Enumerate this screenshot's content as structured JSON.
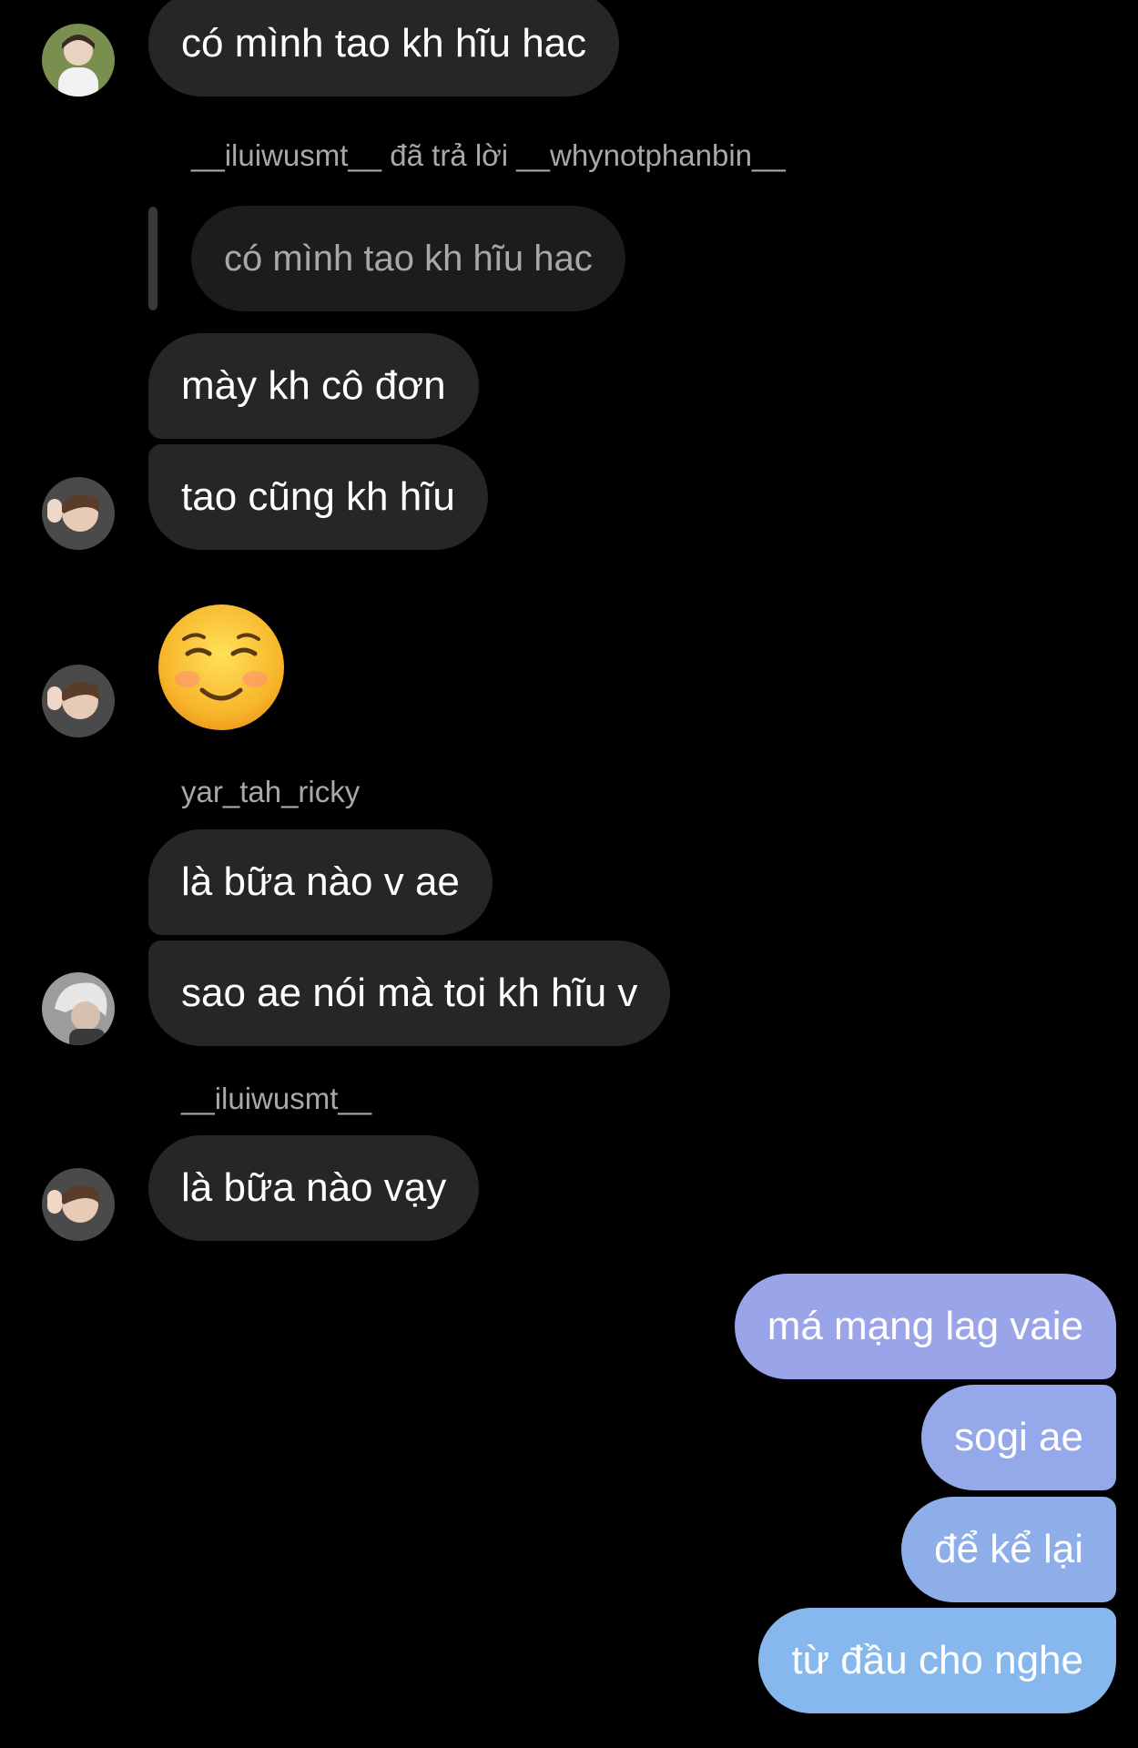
{
  "thread": {
    "messages": [
      {
        "text": "có mình tao kh hĩu hac"
      },
      {
        "reply_header": "__iluiwusmt__ đã trả lời __whynotphanbin__",
        "quoted": "có mình tao kh hĩu hac"
      },
      {
        "text": "mày kh cô đơn"
      },
      {
        "text": "tao cũng kh hĩu"
      },
      {
        "emoji": "smiling-face-icon"
      },
      {
        "sender": "yar_tah_ricky"
      },
      {
        "text": "là bữa nào v ae"
      },
      {
        "text": "sao ae nói mà toi kh hĩu v"
      },
      {
        "sender": "__iluiwusmt__"
      },
      {
        "text": "là bữa nào vạy"
      }
    ],
    "outgoing": [
      {
        "text": "má mạng lag vaie",
        "color": "#9aa4e8"
      },
      {
        "text": "sogi ae",
        "color": "#94a8ea"
      },
      {
        "text": "để kể lại",
        "color": "#8eaeea"
      },
      {
        "text": "từ đầu cho nghe",
        "color": "#86b8ee"
      }
    ]
  },
  "colors": {
    "background": "#000000",
    "incoming_bubble": "#262626",
    "meta_text": "#a8a8a8"
  }
}
